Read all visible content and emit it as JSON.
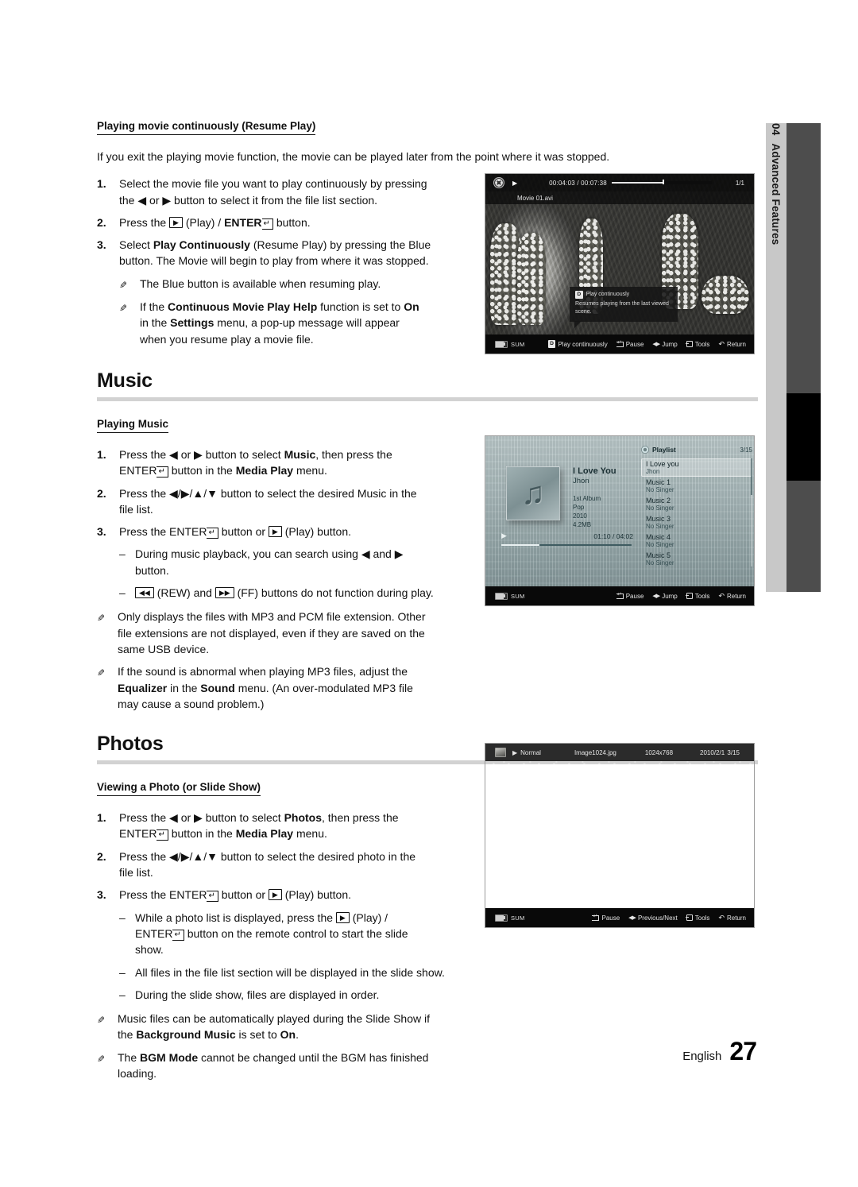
{
  "sidebar": {
    "chapter_number": "04",
    "chapter_title": "Advanced Features"
  },
  "footer": {
    "language": "English",
    "page_number": "27"
  },
  "sections": {
    "resume_play": {
      "subheading": "Playing movie continuously (Resume Play)",
      "intro": "If you exit the playing movie function, the movie can be played later from the point where it was stopped.",
      "step1_num": "1.",
      "step1_a": "Select the movie file you want to play continuously by pressing",
      "step1_b1": "the",
      "step1_b2": "or",
      "step1_b3": "button to select it from the file list section.",
      "step2_num": "2.",
      "step2_a": "Press the",
      "step2_play": "(Play) /",
      "step2_enter": "ENTER",
      "step2_b": "button.",
      "step3_num": "3.",
      "step3_a": "Select",
      "step3_bold": "Play Continuously",
      "step3_b": "(Resume Play) by pressing the Blue",
      "step3_c": "button. The Movie will begin to play from where it was stopped.",
      "note1": "The Blue button is available when resuming play.",
      "note2_a": "If the",
      "note2_bold1": "Continuous Movie Play Help",
      "note2_b": "function is set to",
      "note2_bold2": "On",
      "note2_c": "in the",
      "note2_bold3": "Settings",
      "note2_d": "menu, a pop-up message will appear",
      "note2_e": "when you resume play a movie file."
    },
    "music": {
      "heading": "Music",
      "subheading": "Playing Music",
      "step1_num": "1.",
      "step1_a": "Press the",
      "step1_b": "or",
      "step1_c": "button to select",
      "step1_bold": "Music",
      "step1_d": ", then press the",
      "step1_enter": "ENTER",
      "step1_e": "button in the",
      "step1_bold2": "Media Play",
      "step1_f": "menu.",
      "step2_num": "2.",
      "step2_a": "Press the",
      "step2_keys": "/ / /",
      "step2_b": "button to select the desired Music in the",
      "step2_c": "file list.",
      "step3_num": "3.",
      "step3_a": "Press the",
      "step3_enter": "ENTER",
      "step3_b": "button or",
      "step3_c": "(Play) button.",
      "dash1_a": "During music playback, you can search using",
      "dash1_b": "and",
      "dash1_c": "button.",
      "dash2_a": "(REW) and",
      "dash2_b": "(FF) buttons do not function during play.",
      "note1_a": "Only displays the files with MP3 and PCM file extension. Other",
      "note1_b": "file extensions are not displayed, even if they are saved on the",
      "note1_c": "same USB device.",
      "note2_a": "If the sound is abnormal when playing MP3 files, adjust the",
      "note2_bold1": "Equalizer",
      "note2_b": "in the",
      "note2_bold2": "Sound",
      "note2_c": "menu. (An over-modulated MP3 file",
      "note2_d": "may cause a sound problem.)"
    },
    "photos": {
      "heading": "Photos",
      "subheading": "Viewing a Photo (or Slide Show)",
      "step1_num": "1.",
      "step1_a": "Press the",
      "step1_b": "or",
      "step1_c": "button to select",
      "step1_bold": "Photos",
      "step1_d": ", then press the",
      "step1_enter": "ENTER",
      "step1_e": "button in the",
      "step1_bold2": "Media Play",
      "step1_f": "menu.",
      "step2_num": "2.",
      "step2_a": "Press the",
      "step2_keys": "/ / /",
      "step2_b": "button to select the desired photo in the",
      "step2_c": "file list.",
      "step3_num": "3.",
      "step3_a": "Press the",
      "step3_enter": "ENTER",
      "step3_b": "button or",
      "step3_c": "(Play) button.",
      "dash1_a": "While a photo list is displayed, press the",
      "dash1_b": "(Play) /",
      "dash1_enter": "ENTER",
      "dash1_c": "button on the remote control to start the slide",
      "dash1_d": "show.",
      "dash2": "All files in the file list section will be displayed in the slide show.",
      "dash3": "During the slide show, files are displayed in order.",
      "note1_a": "Music files can be automatically played during the Slide Show if",
      "note1_b": "the",
      "note1_bold": "Background Music",
      "note1_c": "is set to",
      "note1_bold2": "On",
      "note1_d": ".",
      "note2_a": "The",
      "note2_bold": "BGM Mode",
      "note2_b": "cannot be changed until the BGM has finished",
      "note2_c": "loading."
    }
  },
  "screenshots": {
    "movie": {
      "time_current": "00:04:03",
      "time_total": "00:07:38",
      "time_display": "00:04:03 / 00:07:38",
      "index": "1/1",
      "filename": "Movie 01.avi",
      "tooltip_badge": "D",
      "tooltip_title": "Play continuously",
      "tooltip_body": "Resumes playing from the last viewed scene.",
      "usb_label": "SUM",
      "actions": [
        {
          "badge": "D",
          "label": "Play continuously"
        },
        {
          "icon": "enter-icon",
          "label": "Pause"
        },
        {
          "icon": "left-right-icon",
          "label": "Jump"
        },
        {
          "icon": "tools-icon",
          "label": "Tools"
        },
        {
          "icon": "return-icon",
          "label": "Return"
        }
      ]
    },
    "music": {
      "track_title": "I Love You",
      "track_artist": "Jhon",
      "album": "1st Album",
      "genre": "Pop",
      "year": "2010",
      "filesize": "4.2MB",
      "elapsed": "01:10 / 04:02",
      "playlist_title": "Playlist",
      "playlist_count": "3/15",
      "playlist": [
        {
          "name": "I Love you",
          "artist": "Jhon",
          "selected": true
        },
        {
          "name": "Music 1",
          "artist": "No Singer",
          "selected": false
        },
        {
          "name": "Music 2",
          "artist": "No Singer",
          "selected": false
        },
        {
          "name": "Music 3",
          "artist": "No Singer",
          "selected": false
        },
        {
          "name": "Music 4",
          "artist": "No Singer",
          "selected": false
        },
        {
          "name": "Music 5",
          "artist": "No Singer",
          "selected": false
        }
      ],
      "usb_label": "SUM",
      "actions": [
        {
          "icon": "enter-icon",
          "label": "Pause"
        },
        {
          "icon": "left-right-icon",
          "label": "Jump"
        },
        {
          "icon": "tools-icon",
          "label": "Tools"
        },
        {
          "icon": "return-icon",
          "label": "Return"
        }
      ]
    },
    "photo": {
      "mode": "Normal",
      "filename": "Image1024.jpg",
      "resolution": "1024x768",
      "date": "2010/2/1",
      "index": "3/15",
      "usb_label": "SUM",
      "actions": [
        {
          "icon": "enter-icon",
          "label": "Pause"
        },
        {
          "icon": "left-right-icon",
          "label": "Previous/Next"
        },
        {
          "icon": "tools-icon",
          "label": "Tools"
        },
        {
          "icon": "return-icon",
          "label": "Return"
        }
      ]
    }
  },
  "glyphs": {
    "left": "◀",
    "right": "▶",
    "up": "▲",
    "down": "▼",
    "play": "▶",
    "rew": "◀◀",
    "ff": "▶▶",
    "enter_arrow": "↵",
    "pencil": "✎",
    "dash": "–",
    "return": "↺"
  }
}
